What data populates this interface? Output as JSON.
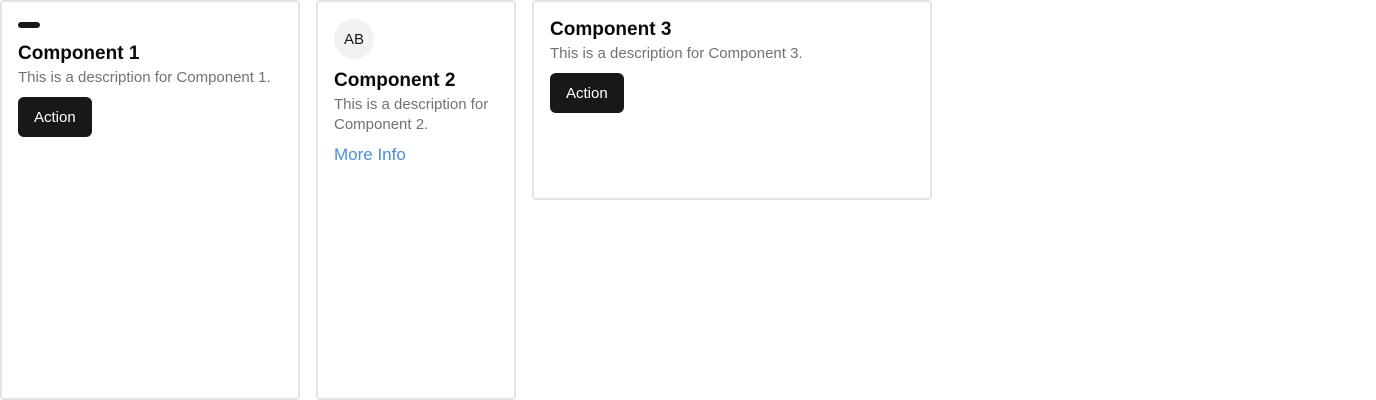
{
  "cards": [
    {
      "title": "Component 1",
      "description": "This is a description for Component 1.",
      "icon": "dash-icon",
      "action_label": "Action"
    },
    {
      "title": "Component 2",
      "description": "This is a description for Component 2.",
      "avatar_initials": "AB",
      "link_label": "More Info"
    },
    {
      "title": "Component 3",
      "description": "This is a description for Component 3.",
      "action_label": "Action"
    }
  ],
  "colors": {
    "button_bg": "#18181b",
    "link": "#4a8fd6",
    "description": "#71717a",
    "border": "#e4e4e7"
  }
}
